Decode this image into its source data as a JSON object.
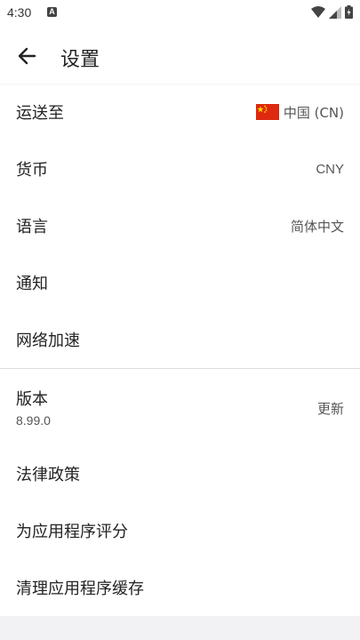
{
  "status_bar": {
    "time": "4:30",
    "notification_badge": "A"
  },
  "header": {
    "title": "设置"
  },
  "settings_group_1": [
    {
      "label": "运送至",
      "value": "中国 (CN)"
    },
    {
      "label": "货币",
      "value": "CNY"
    },
    {
      "label": "语言",
      "value": "简体中文"
    },
    {
      "label": "通知",
      "value": ""
    },
    {
      "label": "网络加速",
      "value": ""
    }
  ],
  "version": {
    "label": "版本",
    "number": "8.99.0",
    "action": "更新"
  },
  "settings_group_2": [
    {
      "label": "法律政策"
    },
    {
      "label": "为应用程序评分"
    },
    {
      "label": "清理应用程序缓存"
    }
  ],
  "colors": {
    "flag_red": "#de2910",
    "flag_yellow": "#ffde00"
  },
  "icons": {
    "back": "arrow-left-icon",
    "flag": "china-flag-icon",
    "wifi": "wifi-icon",
    "signal": "signal-icon",
    "battery": "battery-icon"
  }
}
